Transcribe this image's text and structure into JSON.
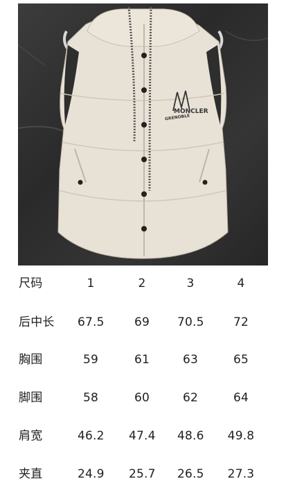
{
  "product_image": {
    "brand_text": "MONCLER",
    "sub_brand_text": "GRENOBLE"
  },
  "size_table": {
    "header": {
      "label": "尺码",
      "sizes": [
        "1",
        "2",
        "3",
        "4"
      ]
    },
    "rows": [
      {
        "label": "后中长",
        "values": [
          "67.5",
          "69",
          "70.5",
          "72"
        ]
      },
      {
        "label": "胸围",
        "values": [
          "59",
          "61",
          "63",
          "65"
        ]
      },
      {
        "label": "脚围",
        "values": [
          "58",
          "60",
          "62",
          "64"
        ]
      },
      {
        "label": "肩宽",
        "values": [
          "46.2",
          "47.4",
          "48.6",
          "49.8"
        ]
      },
      {
        "label": "夹直",
        "values": [
          "24.9",
          "25.7",
          "26.5",
          "27.3"
        ]
      }
    ]
  }
}
